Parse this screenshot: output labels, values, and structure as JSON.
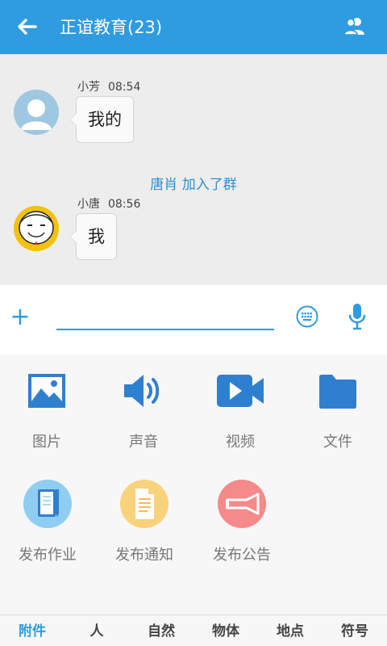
{
  "header": {
    "title": "正谊教育(23)",
    "back_icon": "back-arrow-icon",
    "members_icon": "members-icon"
  },
  "colors": {
    "accent": "#2f9be0",
    "system_note": "#2f8fd0"
  },
  "chat": {
    "messages": [
      {
        "sender": "小芳",
        "time": "08:54",
        "text": "我的"
      },
      {
        "sender": "小唐",
        "time": "08:56",
        "text": "我"
      }
    ],
    "system_note": "唐肖 加入了群"
  },
  "input": {
    "value": "",
    "placeholder": ""
  },
  "tools_row1": [
    {
      "label": "图片",
      "icon": "image-icon"
    },
    {
      "label": "声音",
      "icon": "speaker-icon"
    },
    {
      "label": "视频",
      "icon": "video-icon"
    },
    {
      "label": "文件",
      "icon": "folder-icon"
    }
  ],
  "tools_row2": [
    {
      "label": "发布作业",
      "icon": "notebook-icon"
    },
    {
      "label": "发布通知",
      "icon": "document-icon"
    },
    {
      "label": "发布公告",
      "icon": "megaphone-icon"
    }
  ],
  "tabs": [
    {
      "label": "附件",
      "active": true
    },
    {
      "label": "人",
      "active": false
    },
    {
      "label": "自然",
      "active": false
    },
    {
      "label": "物体",
      "active": false
    },
    {
      "label": "地点",
      "active": false
    },
    {
      "label": "符号",
      "active": false
    }
  ]
}
